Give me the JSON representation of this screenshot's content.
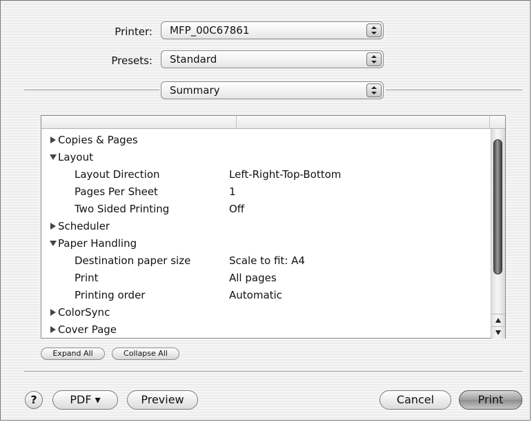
{
  "printer": {
    "label": "Printer:",
    "value": "MFP_00C67861"
  },
  "presets": {
    "label": "Presets:",
    "value": "Standard"
  },
  "panel": {
    "value": "Summary"
  },
  "summary": {
    "rows": [
      {
        "label": "Copies & Pages",
        "value": "",
        "expanded": false
      },
      {
        "label": "Layout",
        "value": "",
        "expanded": true
      },
      {
        "label": "Layout Direction",
        "value": "Left-Right-Top-Bottom"
      },
      {
        "label": "Pages Per Sheet",
        "value": "1"
      },
      {
        "label": "Two Sided Printing",
        "value": "Off"
      },
      {
        "label": "Scheduler",
        "value": "",
        "expanded": false
      },
      {
        "label": "Paper Handling",
        "value": "",
        "expanded": true
      },
      {
        "label": "Destination paper size",
        "value": "Scale to fit: A4"
      },
      {
        "label": "Print",
        "value": "All pages"
      },
      {
        "label": "Printing order",
        "value": "Automatic"
      },
      {
        "label": "ColorSync",
        "value": "",
        "expanded": false
      },
      {
        "label": "Cover Page",
        "value": "",
        "expanded": false
      }
    ]
  },
  "buttons": {
    "expand_all": "Expand All",
    "collapse_all": "Collapse All",
    "help": "?",
    "pdf": "PDF ▾",
    "preview": "Preview",
    "cancel": "Cancel",
    "print": "Print"
  },
  "icons": {
    "disclosure_collapsed": "triangle-right-icon",
    "disclosure_expanded": "triangle-down-icon",
    "popup_stepper": "up-down-arrows-icon"
  }
}
